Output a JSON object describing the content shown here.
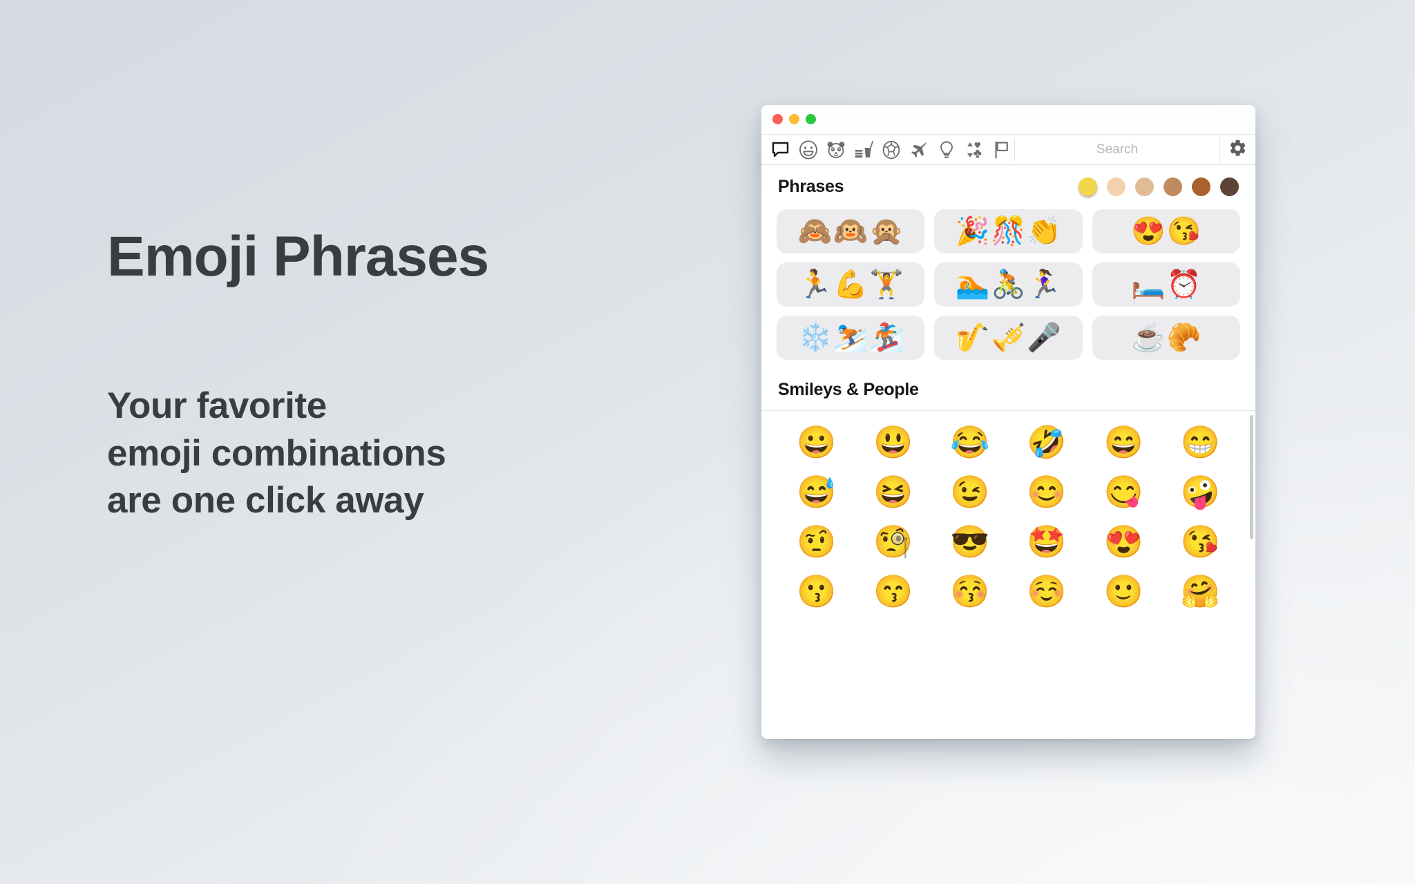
{
  "promo": {
    "title": "Emoji Phrases",
    "subtitle": "Your favorite\nemoji combinations\nare one click away"
  },
  "colors": {
    "background_top_left": "#D5DBE1",
    "background_bottom_right": "#F1F3F5",
    "text": "#3A3D40",
    "window_bg": "#FFFFFF",
    "tile_bg": "#ECECEE",
    "traffic_red": "#FF5F57",
    "traffic_yellow": "#FEBC2E",
    "traffic_green": "#28C840"
  },
  "window": {
    "traffic_lights": [
      {
        "name": "close",
        "color": "#FF5F57"
      },
      {
        "name": "minimize",
        "color": "#FEBC2E"
      },
      {
        "name": "zoom",
        "color": "#28C840"
      }
    ],
    "toolbar": {
      "categories": [
        {
          "icon": "speech-bubble-icon",
          "label": "Phrases",
          "selected": true
        },
        {
          "icon": "smiley-face-icon",
          "label": "Smileys & People",
          "selected": false
        },
        {
          "icon": "panda-icon",
          "label": "Animals & Nature",
          "selected": false
        },
        {
          "icon": "food-drink-icon",
          "label": "Food & Drink",
          "selected": false
        },
        {
          "icon": "soccer-ball-icon",
          "label": "Activity",
          "selected": false
        },
        {
          "icon": "airplane-icon",
          "label": "Travel & Places",
          "selected": false
        },
        {
          "icon": "lightbulb-icon",
          "label": "Objects",
          "selected": false
        },
        {
          "icon": "card-suits-icon",
          "label": "Symbols",
          "selected": false
        },
        {
          "icon": "flag-icon",
          "label": "Flags",
          "selected": false
        }
      ],
      "search": {
        "placeholder": "Search",
        "value": ""
      },
      "settings": {
        "icon": "gear-icon",
        "label": "Settings"
      }
    },
    "phrases_section": {
      "title": "Phrases",
      "skin_tones": [
        {
          "name": "yellow-default",
          "color": "#F2D64B",
          "selected": true
        },
        {
          "name": "light",
          "color": "#F5D0AE",
          "selected": false
        },
        {
          "name": "medium-light",
          "color": "#E0BB95",
          "selected": false
        },
        {
          "name": "medium",
          "color": "#C08B5F",
          "selected": false
        },
        {
          "name": "medium-dark",
          "color": "#A9622F",
          "selected": false
        },
        {
          "name": "dark",
          "color": "#5C4438",
          "selected": false
        }
      ],
      "tiles": [
        {
          "name": "see-hear-speak-no-evil",
          "emojis": [
            "🙈",
            "🙉",
            "🙊"
          ]
        },
        {
          "name": "celebration",
          "emojis": [
            "🎉",
            "🎊",
            "👏"
          ]
        },
        {
          "name": "love-kiss",
          "emojis": [
            "😍",
            "😘"
          ]
        },
        {
          "name": "workout",
          "emojis": [
            "🏃",
            "💪",
            "🏋️"
          ]
        },
        {
          "name": "triathlon",
          "emojis": [
            "🏊",
            "🚴",
            "🏃‍♀️"
          ]
        },
        {
          "name": "bedtime-alarm",
          "emojis": [
            "🛏️",
            "⏰"
          ]
        },
        {
          "name": "winter-sports",
          "emojis": [
            "❄️",
            "⛷️",
            "🏂"
          ]
        },
        {
          "name": "music-performance",
          "emojis": [
            "🎷",
            "🎺",
            "🎤"
          ]
        },
        {
          "name": "coffee-croissant",
          "emojis": [
            "☕",
            "🥐"
          ]
        }
      ]
    },
    "smileys_section": {
      "title": "Smileys & People",
      "emojis": [
        "😀",
        "😃",
        "😂",
        "🤣",
        "😄",
        "😁",
        "😅",
        "😆",
        "😉",
        "😊",
        "😋",
        "🤪",
        "🤨",
        "🧐",
        "😎",
        "🤩",
        "😍",
        "😘",
        "😗",
        "😙",
        "😚",
        "☺️",
        "🙂",
        "🤗"
      ]
    }
  }
}
